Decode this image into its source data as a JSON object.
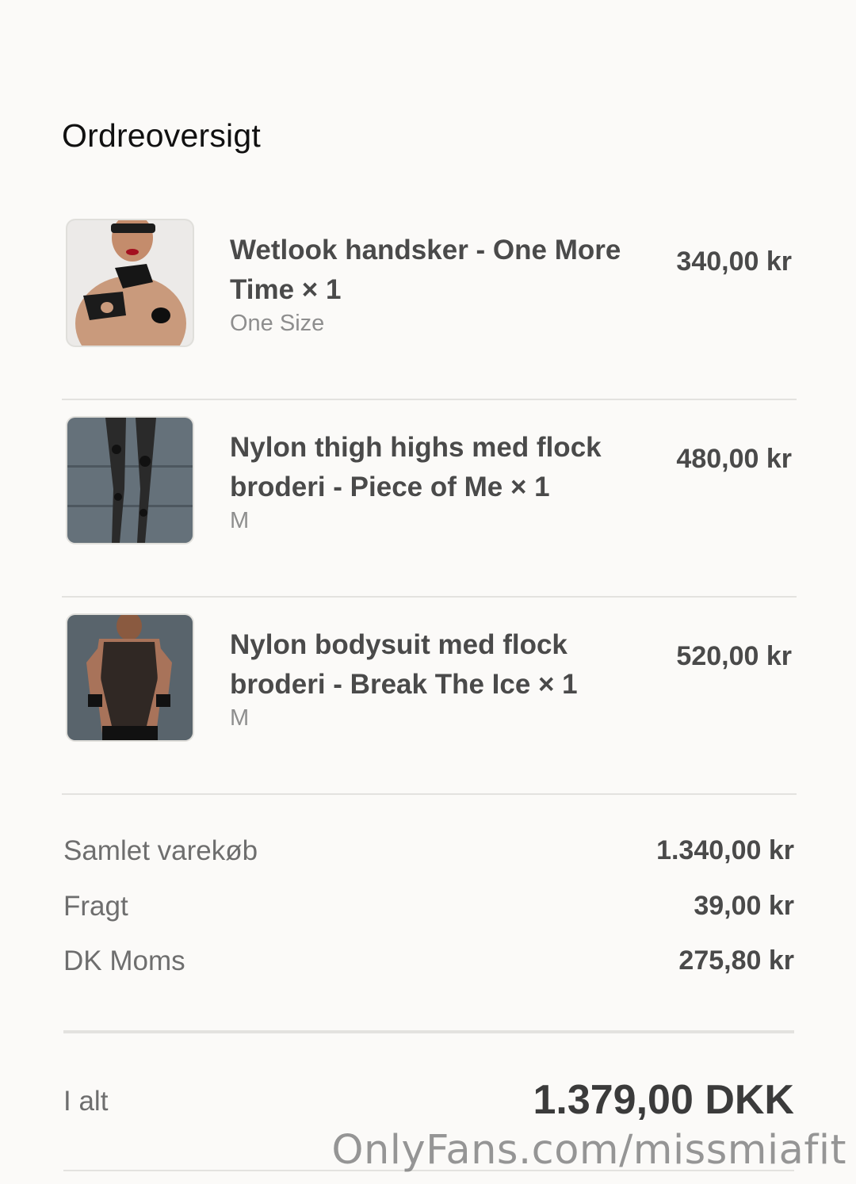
{
  "header": {
    "title": "Ordreoversigt"
  },
  "items": [
    {
      "name": "Wetlook handsker - One More Time × 1",
      "variant": "One Size",
      "price": "340,00 kr",
      "image_icon": "product-gloves-photo"
    },
    {
      "name": "Nylon thigh highs med flock broderi - Piece of Me × 1",
      "variant": "M",
      "price": "480,00 kr",
      "image_icon": "product-stockings-photo"
    },
    {
      "name": "Nylon bodysuit med flock broderi - Break The Ice × 1",
      "variant": "M",
      "price": "520,00 kr",
      "image_icon": "product-bodysuit-photo"
    }
  ],
  "summary": {
    "subtotal_label": "Samlet varekøb",
    "subtotal_value": "1.340,00 kr",
    "shipping_label": "Fragt",
    "shipping_value": "39,00 kr",
    "vat_label": "DK Moms",
    "vat_value": "275,80 kr"
  },
  "total": {
    "label": "I alt",
    "value": "1.379,00 DKK"
  },
  "watermark": "OnlyFans.com/missmiafit",
  "colors": {
    "background": "#fbfaf8",
    "text_dark": "#4a4a4a",
    "text_muted": "#8e8e8e",
    "divider": "#e3e2df"
  }
}
